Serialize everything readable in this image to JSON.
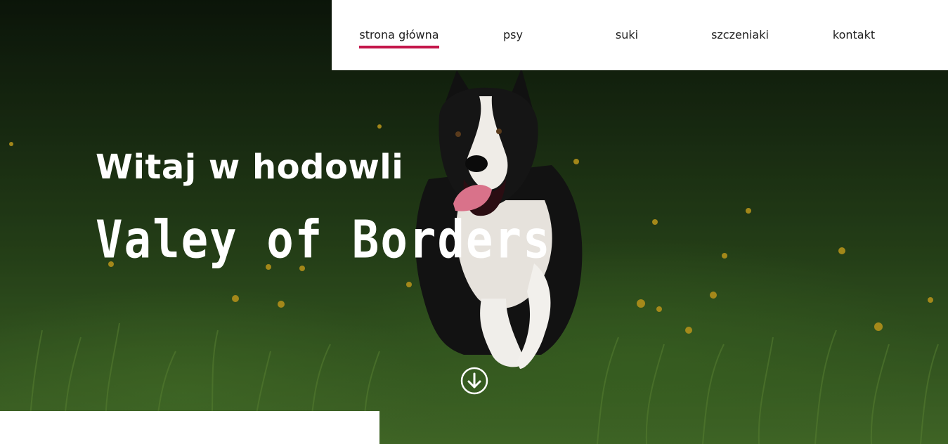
{
  "nav": {
    "items": [
      {
        "label": "strona główna",
        "active": true
      },
      {
        "label": "psy",
        "active": false
      },
      {
        "label": "suki",
        "active": false
      },
      {
        "label": "szczeniaki",
        "active": false
      },
      {
        "label": "kontakt",
        "active": false
      }
    ]
  },
  "hero": {
    "headline": "Witaj w hodowli",
    "brand": "Valey of Borders",
    "scroll_icon": "arrow-down-circle-icon"
  },
  "colors": {
    "accent": "#c4154a",
    "nav_bg": "#ffffff",
    "hero_text": "#ffffff"
  }
}
